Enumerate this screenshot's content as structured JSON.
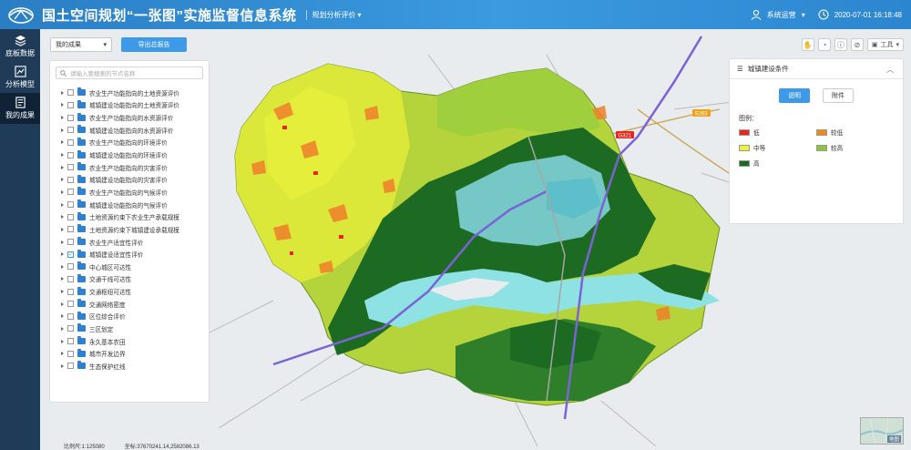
{
  "header": {
    "title": "国土空间规划“一张图”实施监督信息系统",
    "module": "规划分析评价",
    "user": "系统运营",
    "datetime": "2020-07-01 16:18:48"
  },
  "sidenav": {
    "items": [
      {
        "label": "底板数据",
        "icon": "layers-icon",
        "active": false
      },
      {
        "label": "分析模型",
        "icon": "chart-icon",
        "active": false
      },
      {
        "label": "我的成果",
        "icon": "document-icon",
        "active": true
      }
    ]
  },
  "controls": {
    "scope_select": "我的成果",
    "export_button": "导出总报告"
  },
  "tree": {
    "search_placeholder": "请输入要搜索的节点名称",
    "items": [
      {
        "label": "农业生产功能指向的土地资源评价",
        "checked": false
      },
      {
        "label": "城镇建设功能指向的土地资源评价",
        "checked": false
      },
      {
        "label": "农业生产功能指向的水资源评价",
        "checked": false
      },
      {
        "label": "城镇建设功能指向的水资源评价",
        "checked": false
      },
      {
        "label": "农业生产功能指向的环境评价",
        "checked": false
      },
      {
        "label": "城镇建设功能指向的环境评价",
        "checked": false
      },
      {
        "label": "农业生产功能指向的灾害评价",
        "checked": false
      },
      {
        "label": "城镇建设功能指向的灾害评价",
        "checked": false
      },
      {
        "label": "农业生产功能指向的气候评价",
        "checked": false
      },
      {
        "label": "城镇建设功能指向的气候评价",
        "checked": false
      },
      {
        "label": "土地资源约束下农业生产承载规模",
        "checked": false
      },
      {
        "label": "土地资源约束下城镇建设承载规模",
        "checked": false
      },
      {
        "label": "农业生产适宜性评价",
        "checked": false
      },
      {
        "label": "城镇建设适宜性评价",
        "checked": true
      },
      {
        "label": "中心城区可达性",
        "checked": false
      },
      {
        "label": "交通干线可达性",
        "checked": false
      },
      {
        "label": "交通枢纽可达性",
        "checked": false
      },
      {
        "label": "交通网络密度",
        "checked": false
      },
      {
        "label": "区位综合评价",
        "checked": false
      },
      {
        "label": "三区划定",
        "checked": false
      },
      {
        "label": "永久基本农田",
        "checked": false
      },
      {
        "label": "城市开发边界",
        "checked": false
      },
      {
        "label": "生态保护红线",
        "checked": false
      }
    ]
  },
  "toolbar": {
    "tools_label": "工具"
  },
  "legend": {
    "title": "城镇建设条件",
    "tabs": [
      "说明",
      "附件"
    ],
    "legend_label": "图例：",
    "entries": [
      {
        "label": "低",
        "color": "#e8261e"
      },
      {
        "label": "较低",
        "color": "#f0891c"
      },
      {
        "label": "中等",
        "color": "#ecf23a"
      },
      {
        "label": "较高",
        "color": "#8cc63f"
      },
      {
        "label": "高",
        "color": "#1d6b22"
      }
    ]
  },
  "map": {
    "road_labels": [
      "G321",
      "S263"
    ]
  },
  "status": {
    "scale": "比例尺:1:125080",
    "coords": "坐标:37670241.14,2582086.13"
  },
  "minimap": {
    "label": "地图"
  }
}
